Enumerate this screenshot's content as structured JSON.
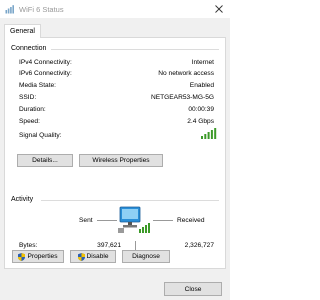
{
  "window": {
    "title": "WiFi 6 Status"
  },
  "tabs": [
    {
      "label": "General"
    }
  ],
  "connection": {
    "section_label": "Connection",
    "rows": [
      {
        "label": "IPv4 Connectivity:",
        "value": "Internet"
      },
      {
        "label": "IPv6 Connectivity:",
        "value": "No network access"
      },
      {
        "label": "Media State:",
        "value": "Enabled"
      },
      {
        "label": "SSID:",
        "value": "NETGEAR53-MG-5G"
      },
      {
        "label": "Duration:",
        "value": "00:00:39"
      },
      {
        "label": "Speed:",
        "value": "2.4 Gbps"
      }
    ],
    "signal_quality_label": "Signal Quality:",
    "signal_bars_filled": 5,
    "signal_bars_total": 5,
    "details_button": "Details...",
    "wireless_properties_button": "Wireless Properties"
  },
  "activity": {
    "section_label": "Activity",
    "sent_label": "Sent",
    "received_label": "Received",
    "bytes_label": "Bytes:",
    "bytes_sent": "397,621",
    "bytes_received": "2,326,727"
  },
  "buttons": {
    "properties": "Properties",
    "disable": "Disable",
    "diagnose": "Diagnose",
    "close": "Close"
  },
  "colors": {
    "signal_green": "#3c9a28",
    "shield_blue": "#2c5fb3",
    "shield_yellow": "#f2c200",
    "monitor_blue": "#2a8fd8"
  }
}
